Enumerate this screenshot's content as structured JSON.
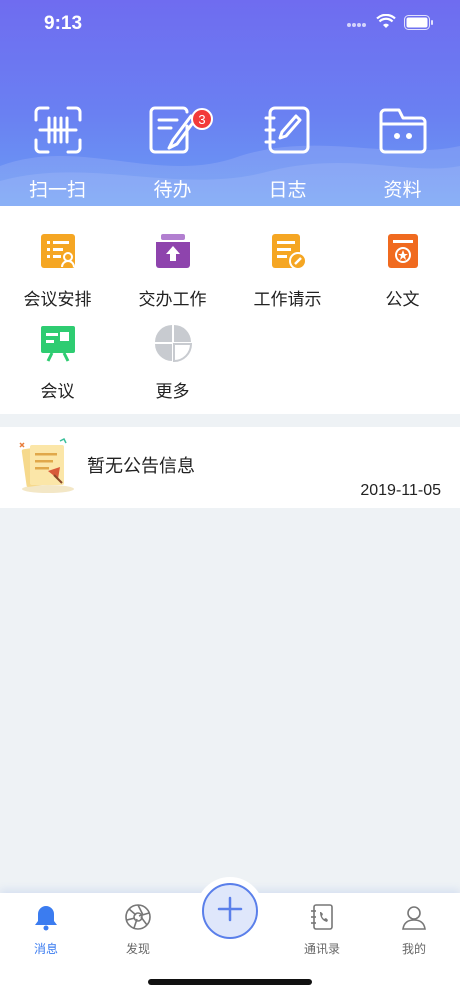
{
  "status": {
    "time": "9:13"
  },
  "top_actions": [
    {
      "label": "扫一扫",
      "icon": "scan-icon"
    },
    {
      "label": "待办",
      "icon": "todo-icon",
      "badge": "3"
    },
    {
      "label": "日志",
      "icon": "log-icon"
    },
    {
      "label": "资料",
      "icon": "folder-icon"
    }
  ],
  "grid": [
    {
      "label": "会议安排",
      "icon": "meeting-schedule-icon",
      "color": "#f5a623"
    },
    {
      "label": "交办工作",
      "icon": "assign-work-icon",
      "color": "#8e44ad"
    },
    {
      "label": "工作请示",
      "icon": "work-request-icon",
      "color": "#f5a623"
    },
    {
      "label": "公文",
      "icon": "document-icon",
      "color": "#f06a1f"
    },
    {
      "label": "会议",
      "icon": "meeting-icon",
      "color": "#2ecc71"
    },
    {
      "label": "更多",
      "icon": "more-icon",
      "color": "#c8cbd0"
    }
  ],
  "notice": {
    "text": "暂无公告信息",
    "date": "2019-11-05"
  },
  "tabbar": [
    {
      "label": "消息",
      "icon": "bell-icon",
      "active": true
    },
    {
      "label": "发现",
      "icon": "aperture-icon"
    },
    {
      "label": "",
      "icon": "plus-icon"
    },
    {
      "label": "通讯录",
      "icon": "contacts-icon"
    },
    {
      "label": "我的",
      "icon": "user-icon"
    }
  ],
  "colors": {
    "header_top": "#6f6cf0",
    "header_bottom": "#6b9cf4",
    "accent": "#3b7cf0",
    "badge": "#f23a3a"
  }
}
